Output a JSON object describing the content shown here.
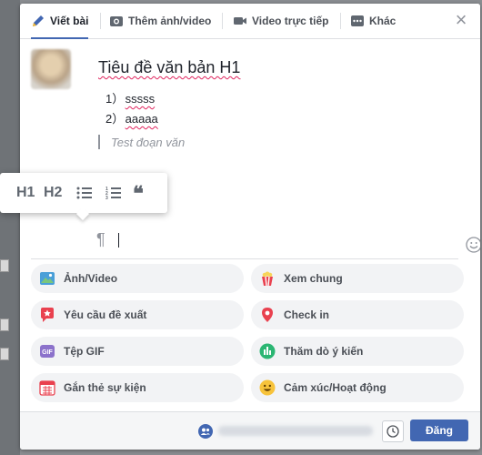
{
  "tabs": [
    {
      "label": "Viết bài",
      "icon": "pencil-icon",
      "active": true
    },
    {
      "label": "Thêm ảnh/video",
      "icon": "camera-icon"
    },
    {
      "label": "Video trực tiếp",
      "icon": "video-camera-icon"
    },
    {
      "label": "Khác",
      "icon": "more-icon"
    }
  ],
  "close_label": "×",
  "editor": {
    "heading": "Tiêu đề văn bản H1",
    "list": [
      {
        "num": "1）",
        "text": "sssss"
      },
      {
        "num": "2）",
        "text": "aaaaa"
      }
    ],
    "paragraph_placeholder": "Test đoạn văn",
    "pilcrow": "¶"
  },
  "format_toolbar": {
    "h1": "H1",
    "h2": "H2",
    "bullets_icon": "bulleted-list-icon",
    "numbers_icon": "numbered-list-icon",
    "quote": "❝"
  },
  "options": [
    {
      "label": "Ảnh/Video",
      "icon": "photo-icon"
    },
    {
      "label": "Xem chung",
      "icon": "popcorn-icon"
    },
    {
      "label": "Yêu cầu đề xuất",
      "icon": "recommendation-icon"
    },
    {
      "label": "Check in",
      "icon": "location-pin-icon"
    },
    {
      "label": "Tệp GIF",
      "icon": "gif-icon"
    },
    {
      "label": "Thăm dò ý kiến",
      "icon": "poll-icon"
    },
    {
      "label": "Gắn thẻ sự kiện",
      "icon": "calendar-icon"
    },
    {
      "label": "Cảm xúc/Hoạt động",
      "icon": "smiley-icon"
    }
  ],
  "footer": {
    "post_label": "Đăng"
  },
  "colors": {
    "brand": "#4267b2",
    "option_bg": "#f2f3f5"
  }
}
